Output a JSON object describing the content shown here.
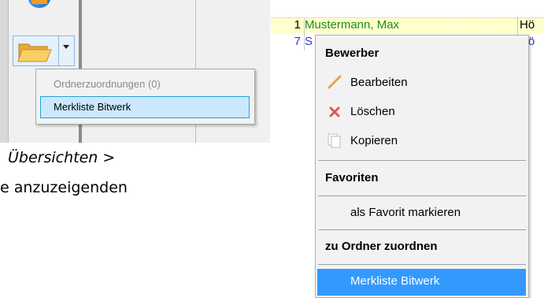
{
  "left_screenshot": {
    "dropdown_menu": {
      "items": [
        {
          "label": "Ordnerzuordnungen (0)",
          "disabled": true
        },
        {
          "label": "Merkliste Bitwerk",
          "selected": true
        }
      ]
    },
    "icons": [
      "globe-icon",
      "folder-open-icon",
      "dropdown-arrow-icon"
    ]
  },
  "document_text": {
    "line1": "Übersichten >",
    "line2": "e anzuzeigenden"
  },
  "right_screenshot": {
    "grid_rows": [
      {
        "number": "1",
        "name": "Mustermann, Max",
        "extra": "Hö"
      },
      {
        "number": "7",
        "name": "S",
        "extra": "Hö"
      }
    ],
    "context_menu": {
      "header_bewerber": "Bewerber",
      "item_bearbeiten": "Bearbeiten",
      "item_loeschen": "Löschen",
      "item_kopieren": "Kopieren",
      "header_favoriten": "Favoriten",
      "item_favorit": "als Favorit markieren",
      "header_ordner": "zu Ordner zuordnen",
      "item_merkliste": "Merkliste Bitwerk"
    },
    "colors": {
      "selection": "#3399ff",
      "row_highlight": "#ffffcc",
      "green_text": "#1f8a1f",
      "blue_text": "#2a35cc"
    }
  }
}
